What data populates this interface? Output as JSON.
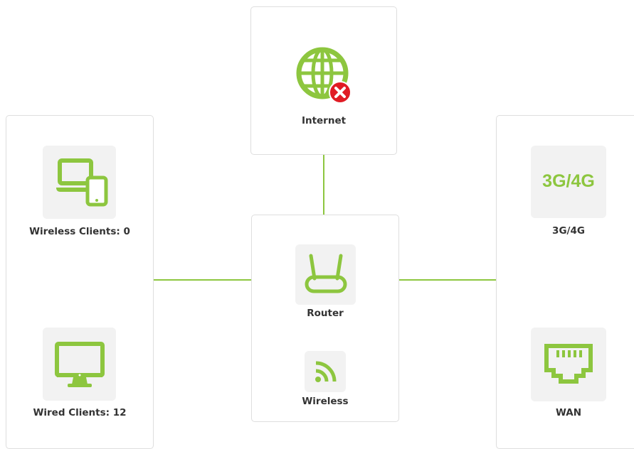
{
  "colors": {
    "accent": "#8dc63f",
    "error": "#e01b24"
  },
  "internet": {
    "label": "Internet",
    "status": "disconnected"
  },
  "wireless_clients": {
    "label": "Wireless Clients: 0"
  },
  "wired_clients": {
    "label": "Wired Clients: 12"
  },
  "router": {
    "label": "Router"
  },
  "wireless": {
    "label": "Wireless"
  },
  "mobile": {
    "label": "3G/4G",
    "icon_text": "3G/4G"
  },
  "wan": {
    "label": "WAN"
  }
}
